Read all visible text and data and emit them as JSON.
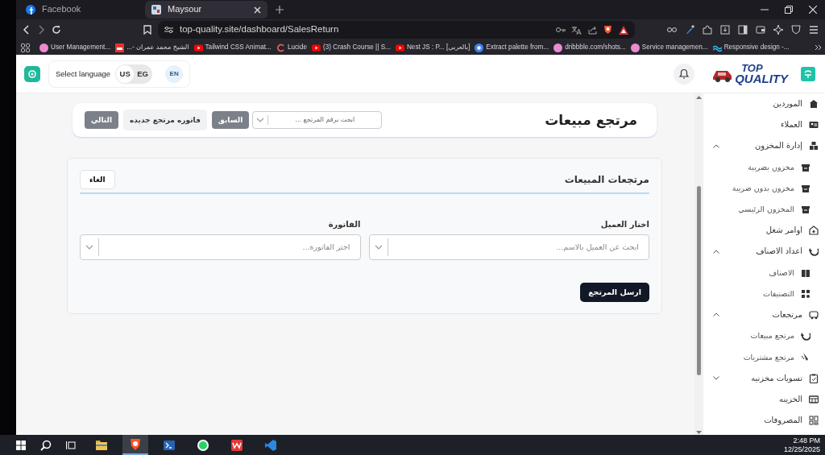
{
  "browser": {
    "tabs": [
      {
        "title": "Maysour",
        "selected": true
      },
      {
        "title": "Facebook",
        "selected": false
      }
    ],
    "url": "top-quality.site/dashboard/SalesReturn",
    "bookmarks": [
      {
        "label": "Responsive design -...",
        "kind": "wave"
      },
      {
        "label": "Service managemen...",
        "kind": "avatar"
      },
      {
        "label": "dribbble.com/shots...",
        "kind": "avatar"
      },
      {
        "label": "Extract palette from...",
        "kind": "palette"
      },
      {
        "label": "Nest JS : P... [بالعربي]",
        "kind": "video"
      },
      {
        "label": "(3) Crash Course || S...",
        "kind": "video"
      },
      {
        "label": "Lucide",
        "kind": "lucide"
      },
      {
        "label": "Tailwind CSS Animat...",
        "kind": "video"
      },
      {
        "label": "الشيخ محمد عمران -...",
        "kind": "red-square"
      },
      {
        "label": "User Management...",
        "kind": "avatar"
      }
    ]
  },
  "header": {
    "language_label": "Select language",
    "languages": [
      {
        "code": "EG",
        "selected": false
      },
      {
        "code": "US",
        "selected": true
      }
    ],
    "locale_badge": "EN",
    "logo_text": [
      "TOP",
      "QUALITY"
    ]
  },
  "page": {
    "title": "مرتجع مبيعات",
    "search_placeholder": "ابحث برقم المرتجع ...",
    "buttons": [
      {
        "label": "السابق",
        "kind": "secondary"
      },
      {
        "label": "فاتوره مرتجع جديده",
        "kind": "light"
      },
      {
        "label": "التالي",
        "kind": "secondary"
      }
    ]
  },
  "form": {
    "title": "مرتجعات المبيعات",
    "cancel": "الغاء",
    "fields": [
      {
        "label": "اختار العميل",
        "placeholder": "ابحث عن العميل بالاسم..."
      },
      {
        "label": "الفاتورة",
        "placeholder": "اختر الفاتورة..."
      }
    ],
    "submit": "ارسل المرتجع"
  },
  "sidebar": {
    "items": [
      {
        "label": "الموردين"
      },
      {
        "label": "العملاء"
      },
      {
        "label": "إدارة المخزون",
        "expanded": true,
        "children": [
          {
            "label": "مخزون بضريبة"
          },
          {
            "label": "مخزون بدون ضريبة"
          },
          {
            "label": "المخزون الرئيسي"
          }
        ]
      },
      {
        "label": "اوامر شغل"
      },
      {
        "label": "اعداد الاصناف",
        "expanded": true,
        "children": [
          {
            "label": "الاصناف"
          },
          {
            "label": "التصنيفات"
          }
        ]
      },
      {
        "label": "مرتجعات",
        "expanded": true,
        "children": [
          {
            "label": "مرتجع مبيعات"
          },
          {
            "label": "مرتجع مشتريات"
          }
        ]
      },
      {
        "label": "تسويات مخزنيه",
        "expanded": false
      },
      {
        "label": "الخزينه"
      },
      {
        "label": "المصروفات"
      }
    ]
  },
  "taskbar": {
    "apps": [
      {
        "selected": false
      },
      {
        "selected": true
      },
      {
        "selected": false
      },
      {
        "selected": false
      },
      {
        "selected": false
      },
      {
        "selected": false
      }
    ],
    "time": "2:48 PM",
    "date": "12/25/2025"
  }
}
